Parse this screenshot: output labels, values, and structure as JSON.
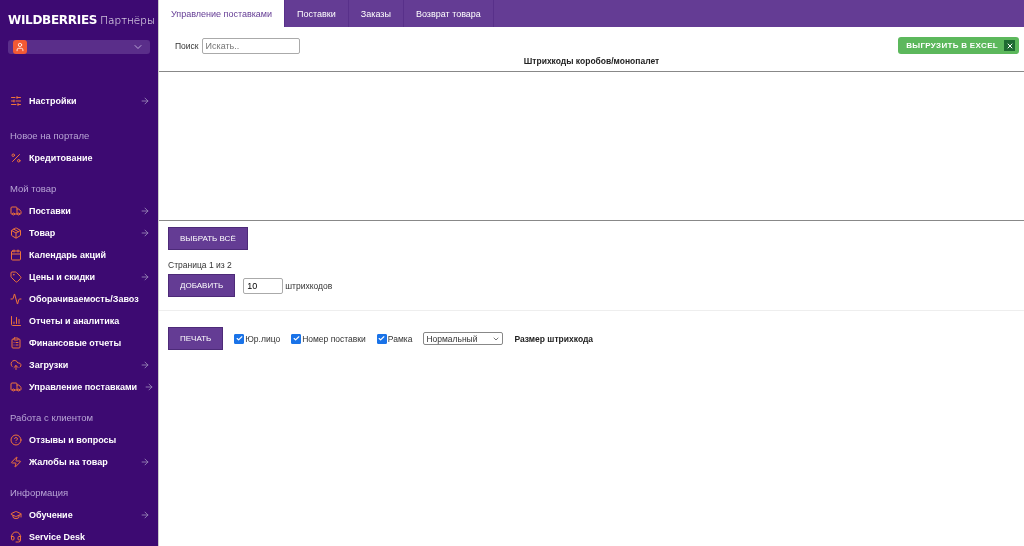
{
  "sidebar": {
    "logo": {
      "brand": "WILDBERRIES",
      "suffix": "Партнёры"
    },
    "sections": [
      {
        "items": [
          {
            "label": "Настройки",
            "arrow": true
          }
        ]
      },
      {
        "title": "Новое на портале",
        "items": [
          {
            "label": "Кредитование",
            "arrow": false
          }
        ]
      },
      {
        "title": "Мой товар",
        "items": [
          {
            "label": "Поставки",
            "arrow": true
          },
          {
            "label": "Товар",
            "arrow": true
          },
          {
            "label": "Календарь акций",
            "arrow": false
          },
          {
            "label": "Цены и скидки",
            "arrow": true
          },
          {
            "label": "Оборачиваемость/Завоз",
            "arrow": false
          },
          {
            "label": "Отчеты и аналитика",
            "arrow": false
          },
          {
            "label": "Финансовые отчеты",
            "arrow": false
          },
          {
            "label": "Загрузки",
            "arrow": true
          },
          {
            "label": "Управление поставками",
            "arrow": true
          }
        ]
      },
      {
        "title": "Работа с клиентом",
        "items": [
          {
            "label": "Отзывы и вопросы",
            "arrow": false
          },
          {
            "label": "Жалобы на товар",
            "arrow": true
          }
        ]
      },
      {
        "title": "Информация",
        "items": [
          {
            "label": "Обучение",
            "arrow": true
          },
          {
            "label": "Service Desk",
            "arrow": false
          }
        ]
      }
    ]
  },
  "tabs": [
    {
      "label": "Управление поставками",
      "selected": true
    },
    {
      "label": "Поставки",
      "selected": false
    },
    {
      "label": "Заказы",
      "selected": false
    },
    {
      "label": "Возврат товара",
      "selected": false
    }
  ],
  "search": {
    "label": "Поиск",
    "placeholder": "Искать.."
  },
  "export_button": "ВЫГРУЗИТЬ В EXCEL",
  "table": {
    "title": "Штрихкоды коробов/монопалет"
  },
  "select_all_button": "ВЫБРАТЬ ВСЁ",
  "pagination": "Страница 1 из 2",
  "add": {
    "button": "ДОБАВИТЬ",
    "value": "10",
    "unit": "штрихкодов"
  },
  "print": {
    "button": "ПЕЧАТЬ",
    "options": [
      {
        "label": "Юр.лицо",
        "checked": true
      },
      {
        "label": "Номер поставки",
        "checked": true
      },
      {
        "label": "Рамка",
        "checked": true
      }
    ],
    "size_select": "Нормальный",
    "size_label": "Размер штрихкода"
  }
}
